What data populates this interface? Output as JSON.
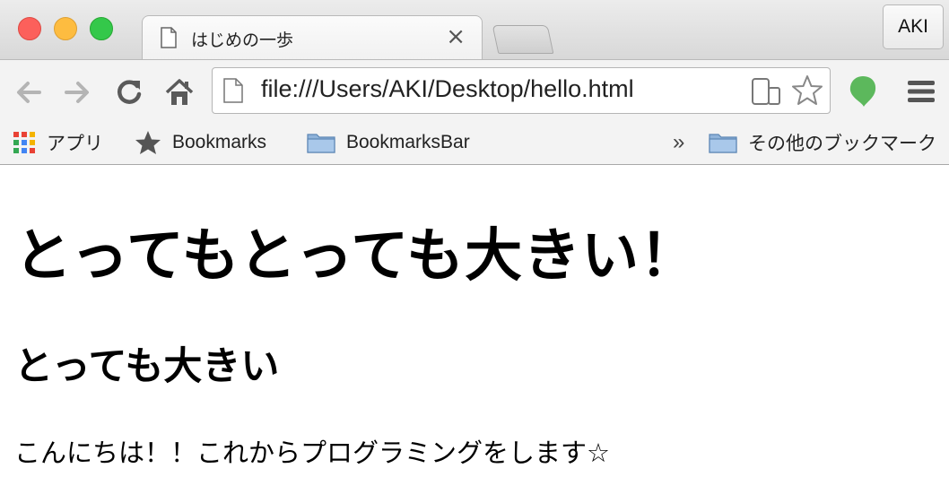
{
  "window": {
    "profile_label": "AKI"
  },
  "tab": {
    "title": "はじめの一歩",
    "close_glyph": "×"
  },
  "toolbar": {
    "url": "file:///Users/AKI/Desktop/hello.html"
  },
  "bookmarks_bar": {
    "items": [
      {
        "label": "アプリ",
        "icon": "apps-grid-icon"
      },
      {
        "label": "Bookmarks",
        "icon": "star-icon"
      },
      {
        "label": "BookmarksBar",
        "icon": "folder-icon"
      }
    ],
    "overflow_glyph": "»",
    "other_bookmarks": {
      "label": "その他のブックマーク",
      "icon": "folder-icon"
    }
  },
  "page": {
    "heading1": "とってもとっても大きい！",
    "heading2": "とっても大きい",
    "paragraph": "こんにちは！！これからプログラミングをします☆"
  },
  "colors": {
    "close": "#fc605b",
    "minimize": "#fdbc40",
    "maximize": "#34c84a",
    "extension_green": "#5cb85c"
  }
}
